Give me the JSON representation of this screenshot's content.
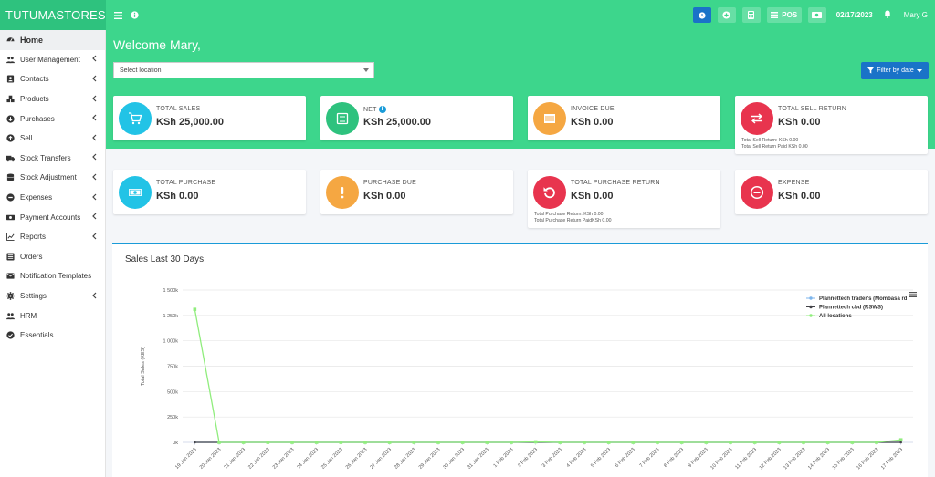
{
  "app": {
    "brand": "TUTUMASTORES"
  },
  "topbar": {
    "pos_label": "POS",
    "date": "02/17/2023",
    "user": "Mary G"
  },
  "sidebar": {
    "items": [
      {
        "label": "Home",
        "icon": "dashboard-icon",
        "chevron": false,
        "active": true
      },
      {
        "label": "User Management",
        "icon": "users-icon",
        "chevron": true
      },
      {
        "label": "Contacts",
        "icon": "address-book-icon",
        "chevron": true
      },
      {
        "label": "Products",
        "icon": "cubes-icon",
        "chevron": true
      },
      {
        "label": "Purchases",
        "icon": "arrow-circle-down-icon",
        "chevron": true
      },
      {
        "label": "Sell",
        "icon": "arrow-circle-up-icon",
        "chevron": true
      },
      {
        "label": "Stock Transfers",
        "icon": "truck-icon",
        "chevron": true
      },
      {
        "label": "Stock Adjustment",
        "icon": "database-icon",
        "chevron": true
      },
      {
        "label": "Expenses",
        "icon": "minus-circle-icon",
        "chevron": true
      },
      {
        "label": "Payment Accounts",
        "icon": "money-icon",
        "chevron": true
      },
      {
        "label": "Reports",
        "icon": "chart-icon",
        "chevron": true
      },
      {
        "label": "Orders",
        "icon": "list-icon",
        "chevron": false
      },
      {
        "label": "Notification Templates",
        "icon": "envelope-icon",
        "chevron": false
      },
      {
        "label": "Settings",
        "icon": "gear-icon",
        "chevron": true
      },
      {
        "label": "HRM",
        "icon": "users-icon",
        "chevron": false
      },
      {
        "label": "Essentials",
        "icon": "check-circle-icon",
        "chevron": false
      }
    ]
  },
  "main": {
    "welcome": "Welcome Mary,",
    "location_placeholder": "Select location",
    "filter_label": "Filter by date",
    "cards": [
      {
        "label": "TOTAL SALES",
        "value": "KSh 25,000.00",
        "color": "#22c3e6",
        "icon": "cart-icon",
        "info": false
      },
      {
        "label": "NET",
        "value": "KSh 25,000.00",
        "color": "#2ec27e",
        "icon": "document-icon",
        "info": true
      },
      {
        "label": "INVOICE DUE",
        "value": "KSh 0.00",
        "color": "#f5a742",
        "icon": "invoice-icon",
        "info": false
      },
      {
        "label": "TOTAL SELL RETURN",
        "value": "KSh 0.00",
        "color": "#e8344e",
        "icon": "exchange-icon",
        "info": false,
        "sub": [
          "Total Sell Return: KSh 0.00",
          "Total Sell Return Paid KSh 0.00"
        ]
      },
      {
        "label": "TOTAL PURCHASE",
        "value": "KSh 0.00",
        "color": "#22c3e6",
        "icon": "money-icon",
        "info": false
      },
      {
        "label": "PURCHASE DUE",
        "value": "KSh 0.00",
        "color": "#f5a742",
        "icon": "exclamation-icon",
        "info": false
      },
      {
        "label": "TOTAL PURCHASE RETURN",
        "value": "KSh 0.00",
        "color": "#e8344e",
        "icon": "undo-icon",
        "info": false,
        "sub": [
          "Total Purchase Return: KSh 0.00",
          "Total Purchase Return PaidKSh 0.00"
        ]
      },
      {
        "label": "EXPENSE",
        "value": "KSh 0.00",
        "color": "#e8344e",
        "icon": "minus-circle-icon",
        "info": false
      }
    ]
  },
  "chart_data": {
    "type": "line",
    "title": "Sales Last 30 Days",
    "ylabel": "Total Sales (KES)",
    "xlabel": "",
    "ylim": [
      0,
      1500000
    ],
    "yticks": [
      "1 500k",
      "1 250k",
      "1 000k",
      "750k",
      "500k",
      "250k",
      "0k"
    ],
    "grid": true,
    "legend_position": "top-right",
    "categories": [
      "19 Jan 2023",
      "20 Jan 2023",
      "21 Jan 2023",
      "22 Jan 2023",
      "23 Jan 2023",
      "24 Jan 2023",
      "25 Jan 2023",
      "26 Jan 2023",
      "27 Jan 2023",
      "28 Jan 2023",
      "29 Jan 2023",
      "30 Jan 2023",
      "31 Jan 2023",
      "1 Feb 2023",
      "2 Feb 2023",
      "3 Feb 2023",
      "4 Feb 2023",
      "5 Feb 2023",
      "6 Feb 2023",
      "7 Feb 2023",
      "8 Feb 2023",
      "9 Feb 2023",
      "10 Feb 2023",
      "11 Feb 2023",
      "12 Feb 2023",
      "13 Feb 2023",
      "14 Feb 2023",
      "15 Feb 2023",
      "16 Feb 2023",
      "17 Feb 2023"
    ],
    "series": [
      {
        "name": "Plannettech trader's (Mombasa rd",
        "color": "#7cb5ec",
        "values": [
          0,
          0,
          0,
          0,
          0,
          0,
          0,
          0,
          0,
          0,
          0,
          0,
          0,
          0,
          0,
          0,
          0,
          0,
          0,
          0,
          0,
          0,
          0,
          0,
          0,
          0,
          0,
          0,
          0,
          0
        ]
      },
      {
        "name": "Plannettech cbd (RSWS)",
        "color": "#434348",
        "values": [
          0,
          0,
          0,
          0,
          0,
          0,
          0,
          0,
          0,
          0,
          0,
          0,
          0,
          0,
          0,
          0,
          0,
          0,
          0,
          0,
          0,
          0,
          0,
          0,
          0,
          0,
          0,
          0,
          0,
          0
        ]
      },
      {
        "name": "All locations",
        "color": "#90ed7d",
        "values": [
          1310000,
          0,
          0,
          0,
          0,
          0,
          0,
          0,
          0,
          0,
          0,
          0,
          0,
          0,
          5000,
          0,
          0,
          0,
          0,
          0,
          0,
          0,
          0,
          0,
          0,
          0,
          0,
          0,
          0,
          25000
        ]
      }
    ]
  }
}
